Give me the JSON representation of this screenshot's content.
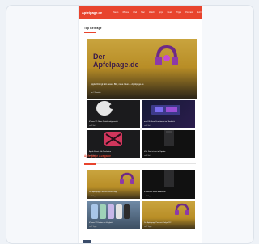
{
  "site": {
    "logo_text": "Apfelpage.de"
  },
  "nav": {
    "items": [
      "News",
      "iPhone",
      "iPad",
      "Mac",
      "Watch",
      "Apps",
      "Deals",
      "Tipps",
      "Podcast",
      "Mehr"
    ]
  },
  "sections": [
    {
      "title": "Top Beiträge"
    },
    {
      "title": "Apfelpage Ausgabe"
    }
  ],
  "hero": {
    "brand_line1": "Der",
    "brand_line2": "Apfelpage.de",
    "caption": "Apple Drängt: Ein neues Bild, neue Ideen – Apfelpage.de",
    "meta": "vor 2 Stunden"
  },
  "tiles": [
    {
      "caption": "iPhone 17: Neue Details aufgetaucht",
      "meta": "vor 3 Std."
    },
    {
      "caption": "macOS: Neue Funktionen im Überblick",
      "meta": "vor 4 Std."
    },
    {
      "caption": "Apple Event: Alle Neuheiten",
      "meta": "vor 5 Std."
    },
    {
      "caption": "iOS: Das ist neu im Update",
      "meta": "vor 6 Std."
    },
    {
      "caption": "Der Apfelpage Podcast: Neue Folge",
      "meta": "vor 1 Tag"
    },
    {
      "caption": "iPhone Air: Erste Eindrücke",
      "meta": "vor 1 Tag"
    },
    {
      "caption": "iPhone 17 Farben im Vergleich",
      "meta": "vor 2 Tagen"
    },
    {
      "caption": "Der Apfelpage Podcast: Folge 212",
      "meta": "vor 2 Tagen"
    }
  ],
  "colors": {
    "brand": "#e8442d",
    "gold": "#c9a43e",
    "dark": "#1b1b1d"
  }
}
